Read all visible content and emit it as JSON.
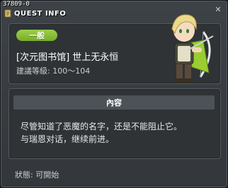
{
  "window": {
    "id_label": "37809-0",
    "title": "QUEST INFO",
    "close_icon": "close-icon"
  },
  "quest": {
    "category_badge": "一般",
    "name": "[次元图书馆] 世上无永恒",
    "level_range": "建議等級: 100～104",
    "npc_image": "elf-archer-npc-portrait"
  },
  "content": {
    "header": "內容",
    "lines": [
      "尽管知道了恶魔的名字，还是不能阻止它。",
      "与瑞恩对话，继续前进。"
    ]
  },
  "status": {
    "text": "狀態: 可開始"
  },
  "colors": {
    "badge_green": "#8cc63f",
    "window_bg": "#3a3f43",
    "panel_bg": "#2f3336"
  }
}
